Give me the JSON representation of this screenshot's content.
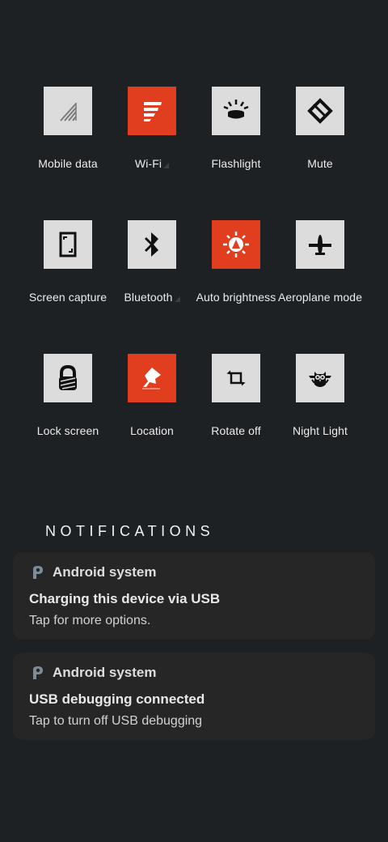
{
  "quick_settings": {
    "tiles": [
      {
        "label": "Mobile data",
        "icon": "signal-icon",
        "active": false
      },
      {
        "label": "Wi-Fi",
        "icon": "wifi-icon",
        "active": true
      },
      {
        "label": "Flashlight",
        "icon": "flashlight-icon",
        "active": false
      },
      {
        "label": "Mute",
        "icon": "mute-icon",
        "active": false
      },
      {
        "label": "Screen capture",
        "icon": "screen-capture-icon",
        "active": false
      },
      {
        "label": "Bluetooth",
        "icon": "bluetooth-icon",
        "active": false
      },
      {
        "label": "Auto brightness",
        "icon": "brightness-icon",
        "active": true
      },
      {
        "label": "Aeroplane mode",
        "icon": "airplane-icon",
        "active": false
      },
      {
        "label": "Lock screen",
        "icon": "lock-icon",
        "active": false
      },
      {
        "label": "Location",
        "icon": "location-icon",
        "active": true
      },
      {
        "label": "Rotate off",
        "icon": "rotate-icon",
        "active": false
      },
      {
        "label": "Night Light",
        "icon": "owl-icon",
        "active": false
      }
    ],
    "colors": {
      "tile_off": "#dcdcdc",
      "tile_on": "#e03e1e",
      "icon": "#111111"
    }
  },
  "notifications": {
    "header": "NOTIFICATIONS",
    "items": [
      {
        "app": "Android system",
        "title": "Charging this device via USB",
        "text": "Tap for more options."
      },
      {
        "app": "Android system",
        "title": "USB debugging connected",
        "text": "Tap to turn off USB debugging"
      }
    ]
  },
  "colors": {
    "background": "#1e2124",
    "card": "#262626",
    "accent": "#e03e1e"
  }
}
